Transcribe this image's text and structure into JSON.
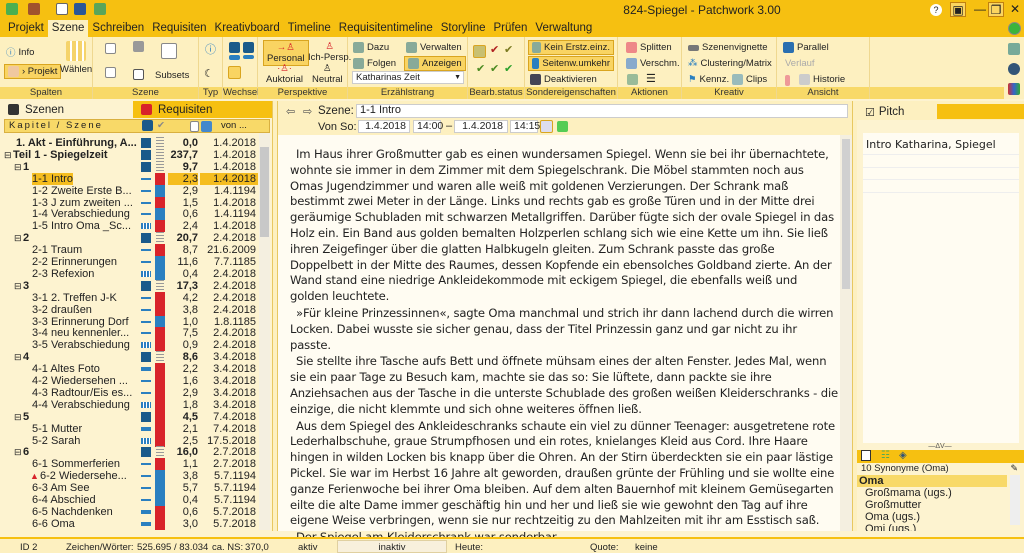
{
  "window": {
    "title": "824-Spiegel  -  Patchwork 3.00"
  },
  "menu": [
    "Projekt",
    "Szene",
    "Schreiben",
    "Requisiten",
    "Kreativboard",
    "Timeline",
    "Requisitentimeline",
    "Storyline",
    "Prüfen",
    "Verwaltung"
  ],
  "ribbon": {
    "spalten": {
      "label": "Spalten",
      "info": "Info",
      "projekt": "› Projekt",
      "waehlen": "Wählen"
    },
    "szene": {
      "label": "Szene",
      "subsets": "Subsets"
    },
    "typ": {
      "label": "Typ"
    },
    "wechsel": {
      "label": "Wechsel"
    },
    "perspektive": {
      "label": "Perspektive",
      "personal": "Personal",
      "ich": "Ich-Persp.",
      "auktorial": "Auktorial",
      "neutral": "Neutral"
    },
    "erzaehlstrang": {
      "label": "Erzählstrang",
      "dazu": "Dazu",
      "folgen": "Folgen",
      "verwalten": "Verwalten",
      "anzeigen": "Anzeigen",
      "select": "Katharinas Zeit"
    },
    "bearb": {
      "label": "Bearb.status"
    },
    "sonder": {
      "label": "Sondereigenschaften",
      "kein": "Kein Erstz.einz.",
      "seitenw": "Seitenw.umkehr",
      "deakt": "Deaktivieren"
    },
    "aktionen": {
      "label": "Aktionen",
      "splitten": "Splitten",
      "verschm": "Verschm."
    },
    "kreativ": {
      "label": "Kreativ",
      "vignette": "Szenenvignette",
      "cluster": "Clustering/Matrix",
      "kennz": "Kennz.",
      "clips": "Clips"
    },
    "ansicht": {
      "label": "Ansicht",
      "parallel": "Parallel",
      "verlauf": "Verlauf",
      "historie": "Historie"
    }
  },
  "left": {
    "tab_szenen": "Szenen",
    "tab_requisiten": "Requisiten",
    "col_kapitel": "Kapitel / Szene",
    "col_von": "von ...",
    "rows": [
      {
        "n": "1. Akt - Einführung, A...",
        "l": 0,
        "b": true,
        "t": "K",
        "s": "gray",
        "v": "0,0",
        "d": "1.4.2018"
      },
      {
        "n": "Teil 1 - Spiegelzeit",
        "l": 0,
        "b": true,
        "t": "K",
        "s": "gray",
        "v": "237,7",
        "d": "1.4.2018",
        "tog": true
      },
      {
        "n": "1",
        "l": 1,
        "b": true,
        "t": "K",
        "s": "gray",
        "v": "9,7",
        "d": "1.4.2018",
        "tog": true
      },
      {
        "n": "1-1 Intro",
        "l": 2,
        "t": "dash",
        "s": "red",
        "v": "2,3",
        "d": "1.4.2018",
        "sel": true
      },
      {
        "n": "1-2 Zweite Erste B...",
        "l": 2,
        "t": "dash",
        "s": "blue",
        "v": "2,9",
        "d": "1.4.1194"
      },
      {
        "n": "1-3 J zum zweiten ...",
        "l": 2,
        "t": "dash",
        "s": "red",
        "v": "1,5",
        "d": "1.4.2018"
      },
      {
        "n": "1-4 Verabschiedung",
        "l": 2,
        "t": "dash",
        "s": "blue",
        "v": "0,6",
        "d": "1.4.1194"
      },
      {
        "n": "1-5 Intro Oma _Sc...",
        "l": 2,
        "t": "dots",
        "s": "red",
        "v": "2,4",
        "d": "1.4.2018"
      },
      {
        "n": "2",
        "l": 1,
        "b": true,
        "t": "K",
        "s": "gray",
        "v": "20,7",
        "d": "2.4.2018",
        "tog": true
      },
      {
        "n": "2-1 Traum",
        "l": 2,
        "t": "dash",
        "s": "red",
        "v": "8,7",
        "d": "21.6.2009"
      },
      {
        "n": "2-2 Erinnerungen",
        "l": 2,
        "t": "dash",
        "s": "blue",
        "v": "11,6",
        "d": "7.7.1185"
      },
      {
        "n": "2-3 Refexion",
        "l": 2,
        "t": "dots",
        "s": "blue",
        "v": "0,4",
        "d": "2.4.2018"
      },
      {
        "n": "3",
        "l": 1,
        "b": true,
        "t": "K",
        "s": "gray",
        "v": "17,3",
        "d": "2.4.2018",
        "tog": true
      },
      {
        "n": "3-1 2. Treffen J-K",
        "l": 2,
        "t": "dash",
        "s": "red",
        "v": "4,2",
        "d": "2.4.2018"
      },
      {
        "n": "3-2 draußen",
        "l": 2,
        "t": "dash",
        "s": "red",
        "v": "3,8",
        "d": "2.4.2018"
      },
      {
        "n": "3-3 Erinnerung Dorf",
        "l": 2,
        "t": "dash",
        "s": "blue",
        "v": "1,0",
        "d": "1.8.1185"
      },
      {
        "n": "3-4 neu kennenler...",
        "l": 2,
        "t": "dash",
        "s": "red",
        "v": "7,5",
        "d": "2.4.2018"
      },
      {
        "n": "3-5 Verabschiedung",
        "l": 2,
        "t": "dots",
        "s": "red",
        "v": "0,9",
        "d": "2.4.2018"
      },
      {
        "n": "4",
        "l": 1,
        "b": true,
        "t": "K",
        "s": "gray",
        "v": "8,6",
        "d": "3.4.2018",
        "tog": true
      },
      {
        "n": "4-1 Altes Foto",
        "l": 2,
        "t": "bar",
        "s": "red",
        "v": "2,2",
        "d": "3.4.2018"
      },
      {
        "n": "4-2 Wiedersehen ...",
        "l": 2,
        "t": "dash",
        "s": "red",
        "v": "1,6",
        "d": "3.4.2018"
      },
      {
        "n": "4-3 Radtour/Eis es...",
        "l": 2,
        "t": "dash",
        "s": "red",
        "v": "2,9",
        "d": "3.4.2018"
      },
      {
        "n": "4-4 Verabschiedung",
        "l": 2,
        "t": "dots",
        "s": "red",
        "v": "1,8",
        "d": "3.4.2018"
      },
      {
        "n": "5",
        "l": 1,
        "b": true,
        "t": "K",
        "s": "red",
        "v": "4,5",
        "d": "7.4.2018",
        "tog": true
      },
      {
        "n": "5-1 Mutter",
        "l": 2,
        "t": "bar",
        "s": "red",
        "v": "2,1",
        "d": "7.4.2018"
      },
      {
        "n": "5-2 Sarah",
        "l": 2,
        "t": "dots",
        "s": "red",
        "v": "2,5",
        "d": "17.5.2018"
      },
      {
        "n": "6",
        "l": 1,
        "b": true,
        "t": "K",
        "s": "gray",
        "v": "16,0",
        "d": "2.7.2018",
        "tog": true
      },
      {
        "n": "6-1 Sommerferien",
        "l": 2,
        "t": "dash",
        "s": "red",
        "v": "1,1",
        "d": "2.7.2018"
      },
      {
        "n": "6-2 Wiedersehe...",
        "l": 2,
        "t": "dash",
        "s": "blue",
        "v": "3,8",
        "d": "5.7.1194",
        "warn": true
      },
      {
        "n": "6-3 Am See",
        "l": 2,
        "t": "dash",
        "s": "blue",
        "v": "5,7",
        "d": "5.7.1194"
      },
      {
        "n": "6-4 Abschied",
        "l": 2,
        "t": "dash",
        "s": "blue",
        "v": "0,4",
        "d": "5.7.1194"
      },
      {
        "n": "6-5 Nachdenken",
        "l": 2,
        "t": "bar",
        "s": "red",
        "v": "0,6",
        "d": "5.7.2018"
      },
      {
        "n": "6-6 Oma",
        "l": 2,
        "t": "bar",
        "s": "red",
        "v": "3,0",
        "d": "5.7.2018"
      }
    ]
  },
  "scene": {
    "szene_label": "Szene:",
    "szene_value": "1-1 Intro",
    "von_label": "Von So:",
    "date_from": "1.4.2018",
    "time_from": "14:00",
    "dash": "–",
    "date_to": "1.4.2018",
    "time_to": "14:15"
  },
  "editor": {
    "paragraphs": [
      "Im Haus ihrer Großmutter gab es einen wundersamen Spiegel. Wenn sie bei ihr übernachtete, wohnte sie immer in dem Zimmer mit dem Spiegelschrank. Die Möbel stammten noch aus Omas Jugendzimmer und waren alle weiß mit goldenen Verzierungen. Der Schrank maß bestimmt zwei Meter in der Länge. Links und rechts gab es große Türen und in der Mitte drei geräumige Schubladen mit schwarzen Metallgriffen. Darüber fügte sich der ovale Spiegel in das Holz ein. Ein Band aus golden bemalten Holzperlen schlang sich wie eine Kette um ihn. Sie ließ ihren Zeigefinger über die glatten Halbkugeln gleiten. Zum Schrank passte das große Doppelbett in der Mitte des Raumes, dessen Kopfende ein ebensolches Goldband zierte. An der Wand stand eine niedrige Ankleidekommode mit eckigem Spiegel, die ebenfalls weiß und golden leuchtete.",
      "»Für kleine Prinzessinnen«, sagte Oma manchmal und strich ihr dann lachend durch die wirren Locken. Dabei wusste sie sicher genau, dass der Titel Prinzessin ganz und gar nicht zu ihr passte.",
      "Sie stellte ihre Tasche aufs Bett und öffnete mühsam eines der alten Fenster. Jedes Mal, wenn sie ein paar Tage zu Besuch kam, machte sie das so: Sie lüftete, dann packte sie ihre Anziehsachen aus der Tasche in die unterste Schublade des großen weißen Kleiderschranks - die einzige, die nicht klemmte und sich ohne weiteres öffnen ließ.",
      "Aus dem Spiegel des Ankleideschranks schaute ein viel zu dünner Teenager: ausgetretene rote Lederhalbschuhe, graue Strumpfhosen und ein rotes, knielanges Kleid aus Cord. Ihre Haare hingen in wilden Locken bis knapp über die Ohren. An der Stirn überdeckten sie ein paar lästige Pickel. Sie war im Herbst 16 Jahre alt geworden, draußen grünte der Frühling und sie wollte eine ganze Ferienwoche bei ihrer Oma bleiben. Auf dem alten Bauernhof mit kleinem Gemüsegarten eilte die alte Dame immer geschäftig hin und her und ließ sie wie gewohnt den Tag auf ihre eigene Weise verbringen, wenn sie nur rechtzeitig zu den Mahlzeiten mit ihr am Esstisch saß.",
      "Der Spiegel am Kleiderschrank war sonderbar."
    ]
  },
  "pitch": {
    "label": "Pitch",
    "checked": true,
    "text": "Intro Katharina, Spiegel"
  },
  "synonyms": {
    "header": "10 Synonyme (Oma)",
    "items": [
      "Oma",
      "Großmama (ugs.)",
      "Großmutter",
      "Oma (ugs.)",
      "Omi (ugs.)"
    ]
  },
  "status": {
    "id": "ID 2",
    "zw_label": "Zeichen/Wörter:",
    "zw_value": "525.695 / 83.034",
    "ns_label": "ca. NS:",
    "ns_value": "370,0",
    "aktiv": "aktiv",
    "inaktiv": "inaktiv",
    "heute": "Heute:",
    "quote_label": "Quote:",
    "quote_value": "keine"
  },
  "colors": {
    "accent": "#f6c011",
    "panel": "#fdf0c0",
    "status_red": "#d8232a",
    "status_blue": "#2a7fc0",
    "type_blue": "#1a5a8a"
  }
}
